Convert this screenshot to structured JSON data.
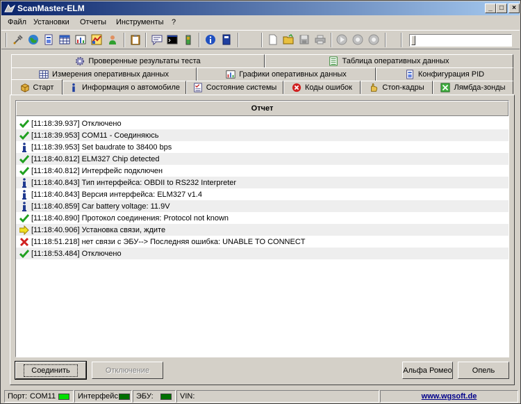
{
  "window": {
    "title": "ScanMaster-ELM",
    "controls": [
      "_",
      "□",
      "×"
    ]
  },
  "menu": [
    "Файл",
    "Установки",
    "Отчеты",
    "Инструменты",
    "?"
  ],
  "tabs": {
    "row1": [
      "Проверенные результаты теста",
      "Таблица оперативных данных"
    ],
    "row2": [
      "Измерения оперативных данных",
      "Графики оперативных данных",
      "Конфигурация PID"
    ],
    "row3": [
      "Старт",
      "Информация о автомобиле",
      "Состояние системы",
      "Коды ошибок",
      "Стоп-кадры",
      "Лямбда-зонды"
    ]
  },
  "report": {
    "header": "Отчет",
    "rows": [
      {
        "icon": "check-icon",
        "text": "[11:18:39.937] Отключено"
      },
      {
        "icon": "check-icon",
        "text": "[11:18:39.953] COM11 - Соединяюсь"
      },
      {
        "icon": "info-icon",
        "text": "[11:18:39.953] Set baudrate to 38400 bps"
      },
      {
        "icon": "check-icon",
        "text": "[11:18:40.812] ELM327 Chip detected"
      },
      {
        "icon": "check-icon",
        "text": "[11:18:40.812] Интерфейс подключен"
      },
      {
        "icon": "info-icon",
        "text": "[11:18:40.843] Тип интерфейса: OBDII to RS232 Interpreter"
      },
      {
        "icon": "info-icon",
        "text": "[11:18:40.843] Версия интерфейса: ELM327 v1.4"
      },
      {
        "icon": "info-icon",
        "text": "[11:18:40.859] Car battery voltage: 11.9V"
      },
      {
        "icon": "check-icon",
        "text": "[11:18:40.890] Протокол соединения: Protocol not known"
      },
      {
        "icon": "arrow-icon",
        "text": "[11:18:40.906] Установка связи, ждите"
      },
      {
        "icon": "error-icon",
        "text": "[11:18:51.218] нет связи с ЭБУ--> Последняя ошибка: UNABLE TO CONNECT"
      },
      {
        "icon": "check-icon",
        "text": "[11:18:53.484] Отключено"
      }
    ]
  },
  "buttons": {
    "connect": "Соединить",
    "disconnect": "Отключение",
    "vehicle": "Альфа Ромео",
    "options": "Опель"
  },
  "status": {
    "port_label": "Порт:",
    "port_value": "COM11",
    "interface_label": "Интерфейс:",
    "ecu_label": "ЭБУ:",
    "vin_label": "VIN:",
    "link": "www.wgsoft.de",
    "colors": {
      "port_led": "#00e000",
      "interface_led": "#007000",
      "ecu_led": "#007000"
    }
  }
}
